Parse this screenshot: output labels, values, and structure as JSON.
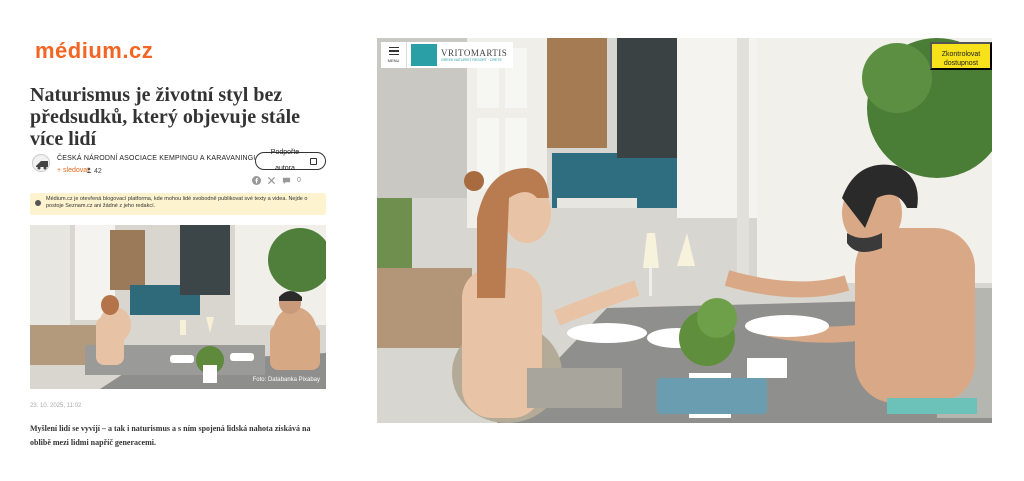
{
  "site": {
    "logo": "médium.cz"
  },
  "article": {
    "title": "Naturismus je životní styl bez předsudků, který objevuje stále více lidí",
    "author": "ČESKÁ NÁRODNÍ ASOCIACE KEMPINGU A KARAVANINGU",
    "follow_label": "+ sledovat",
    "followers": "42",
    "support_label": "Podpořte autora",
    "comments": "0",
    "notice": "Médium.cz je otevřená blogovací platforma, kde mohou lidé svobodně publikovat své texty a videa. Nejde o postoje Seznam.cz ani žádné z jeho redakcí.",
    "photo_caption": "Foto: Databanka Pixabay",
    "date": "23. 10. 2025, 11:02",
    "lead": "Myšlení lidí se vyvíjí – a tak i naturismus a s ním spojená lidská nahota získává na oblibě mezi lidmi napříč generacemi."
  },
  "ad": {
    "menu_label": "MENU",
    "brand_name": "VRITOMARTIS",
    "brand_sub": "GREEK NATURIST RESORT · CRETE",
    "check_label": "Zkontrolovat dostupnost"
  },
  "icons": {
    "facebook": "facebook-icon",
    "x": "x-icon",
    "comment": "comment-icon",
    "info": "info-icon",
    "person": "person-icon",
    "menu": "menu-icon"
  },
  "colors": {
    "brand_orange": "#f26522",
    "notice_bg": "#fdf3cf",
    "cta_yellow": "#f7e11a",
    "resort_teal": "#2a9fa6"
  }
}
